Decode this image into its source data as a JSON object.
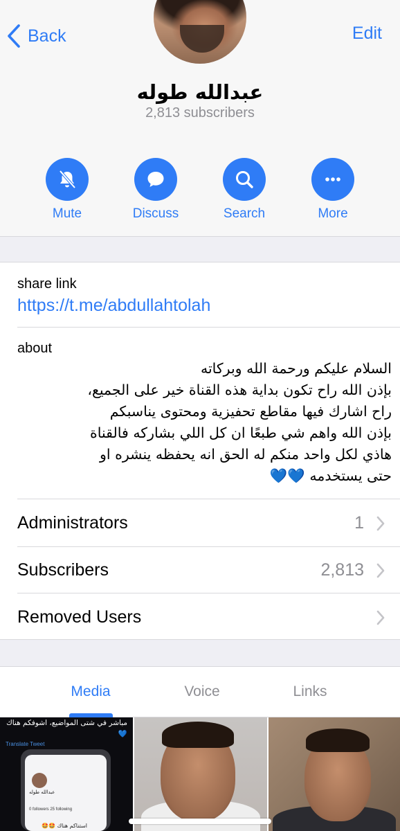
{
  "header": {
    "back_label": "Back",
    "edit_label": "Edit",
    "channel_name": "عبدالله طوله",
    "subscribers_text": "2,813 subscribers"
  },
  "actions": [
    {
      "label": "Mute",
      "icon": "bell-slash-icon"
    },
    {
      "label": "Discuss",
      "icon": "chat-bubble-icon"
    },
    {
      "label": "Search",
      "icon": "search-icon"
    },
    {
      "label": "More",
      "icon": "ellipsis-icon"
    }
  ],
  "info": {
    "share_link_label": "share link",
    "share_link": "https://t.me/abdullahtolah",
    "about_label": "about",
    "about_text": "السلام عليكم ورحمة الله وبركاته\nبإذن الله راح تكون بداية هذه القناة خير على الجميع،\nراح اشارك فيها مقاطع تحفيزية ومحتوى يناسبكم\nبإذن الله واهم شي طبعًا ان كل اللي بشاركه فالقناة\nهاذي لكل واحد منكم له الحق انه يحفظه ينشره او\nحتى يستخدمه 💙💙"
  },
  "rows": [
    {
      "name": "Administrators",
      "value": "1"
    },
    {
      "name": "Subscribers",
      "value": "2,813"
    },
    {
      "name": "Removed Users",
      "value": ""
    }
  ],
  "tabs": [
    {
      "label": "Media",
      "active": true
    },
    {
      "label": "Voice",
      "active": false
    },
    {
      "label": "Links",
      "active": false
    }
  ],
  "media": {
    "thumb1_text": "مباشر في شتى المواضيع، اشوفكم هناك 💙",
    "thumb1_translate": "Translate Tweet",
    "thumb1_profile_name": "عبدالله طوله",
    "thumb1_stats": "0 followers   25 following",
    "thumb1_message": "استناكم هناك 🤩🤩"
  },
  "colors": {
    "accent": "#2f7cf6",
    "secondary_text": "#8e8e93",
    "background": "#efeff4"
  }
}
